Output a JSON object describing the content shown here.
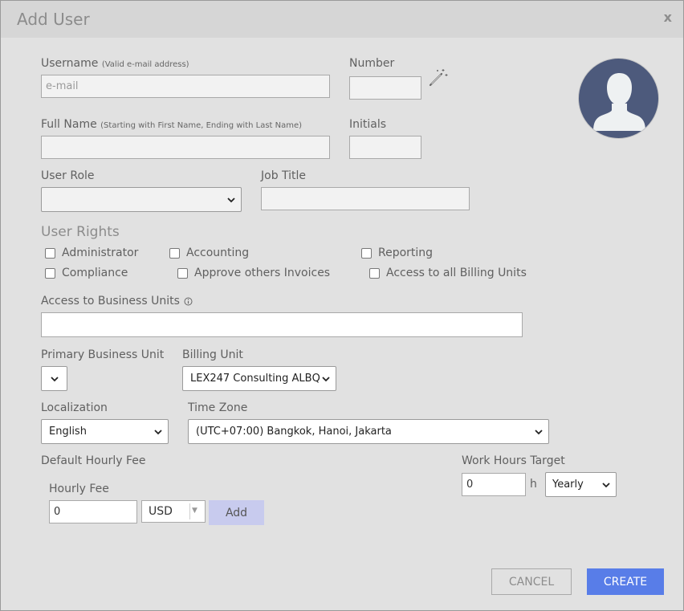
{
  "dialog": {
    "title": "Add User",
    "close_label": "x"
  },
  "username": {
    "label": "Username",
    "hint": "(Valid e-mail address)",
    "placeholder": "e-mail",
    "value": ""
  },
  "number": {
    "label": "Number",
    "value": "",
    "generate_icon": "magic-wand-icon"
  },
  "avatar": {
    "icon": "user-silhouette-icon",
    "color": "#4d5a7c"
  },
  "full_name": {
    "label": "Full Name",
    "hint": "(Starting with First Name, Ending with Last Name)",
    "value": ""
  },
  "initials": {
    "label": "Initials",
    "value": ""
  },
  "user_role": {
    "label": "User Role",
    "selected": ""
  },
  "job_title": {
    "label": "Job Title",
    "value": ""
  },
  "user_rights": {
    "label": "User Rights",
    "options": [
      {
        "label": "Administrator",
        "checked": false
      },
      {
        "label": "Accounting",
        "checked": false
      },
      {
        "label": "Reporting",
        "checked": false
      },
      {
        "label": "Compliance",
        "checked": false
      },
      {
        "label": "Approve others Invoices",
        "checked": false
      },
      {
        "label": "Access to all Billing Units",
        "checked": false
      }
    ]
  },
  "business_units": {
    "label": "Access to Business Units",
    "info_icon": "info-icon",
    "value": ""
  },
  "primary_business_unit": {
    "label": "Primary Business Unit",
    "selected": ""
  },
  "billing_unit": {
    "label": "Billing Unit",
    "selected": "LEX247 Consulting ALBQ"
  },
  "localization": {
    "label": "Localization",
    "selected": "English"
  },
  "time_zone": {
    "label": "Time Zone",
    "selected": "(UTC+07:00) Bangkok, Hanoi, Jakarta"
  },
  "default_hourly_fee": {
    "label": "Default Hourly Fee",
    "fee_label": "Hourly Fee",
    "fee_value": "0",
    "currency": "USD",
    "add_label": "Add"
  },
  "work_hours_target": {
    "label": "Work Hours Target",
    "value": "0",
    "unit": "h",
    "period": "Yearly"
  },
  "buttons": {
    "cancel": "CANCEL",
    "create": "CREATE"
  },
  "colors": {
    "accent": "#587de8",
    "add_button": "#c8cbee",
    "dialog_bg": "#e1e1e1",
    "titlebar_bg": "#d6d6d6"
  }
}
